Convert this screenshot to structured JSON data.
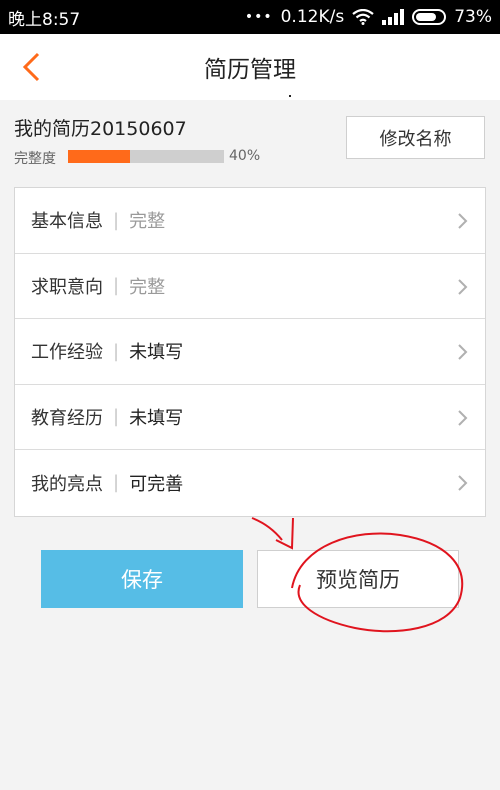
{
  "status_bar": {
    "time": "晚上8:57",
    "dots": "•••",
    "speed": "0.12K/s",
    "battery": "73%"
  },
  "header": {
    "title": "简历管理"
  },
  "resume": {
    "name": "我的简历20150607",
    "progress_label": "完整度",
    "progress_percent": 40,
    "progress_text": "40%",
    "rename_label": "修改名称"
  },
  "sections": [
    {
      "label": "基本信息",
      "separator": "|",
      "status": "完整",
      "state": "done"
    },
    {
      "label": "求职意向",
      "separator": "|",
      "status": "完整",
      "state": "done"
    },
    {
      "label": "工作经验",
      "separator": "|",
      "status": "未填写",
      "state": "todo"
    },
    {
      "label": "教育经历",
      "separator": "|",
      "status": "未填写",
      "state": "todo"
    },
    {
      "label": "我的亮点",
      "separator": "|",
      "status": "可完善",
      "state": "todo"
    }
  ],
  "actions": {
    "save_label": "保存",
    "preview_label": "预览简历"
  },
  "colors": {
    "accent_orange": "#ff6a1a",
    "save_blue": "#56bde6",
    "annotation_red": "#e0141e"
  },
  "icons": {
    "back": "chevron-left-icon",
    "row": "chevron-right-icon"
  }
}
